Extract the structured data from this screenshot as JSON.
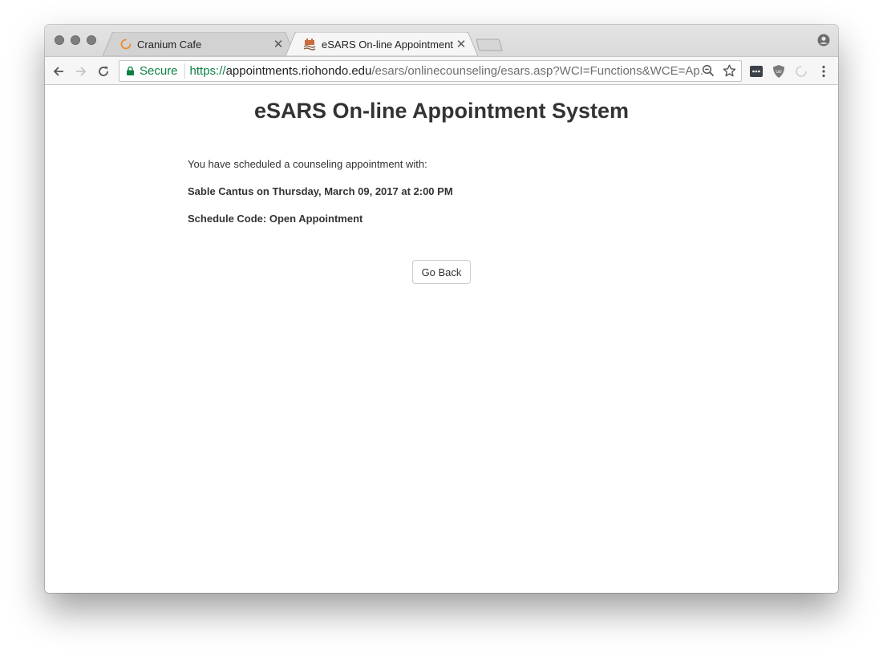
{
  "browser": {
    "tabs": [
      {
        "title": "Cranium Cafe",
        "icon": "loading-spinner-icon",
        "active": false
      },
      {
        "title": "eSARS On-line Appointment S",
        "icon": "college-logo-icon",
        "active": true
      }
    ],
    "toolbar": {
      "secure_label": "Secure",
      "url_scheme": "https://",
      "url_host": "appointments.riohondo.edu",
      "url_path": "/esars/onlinecounseling/esars.asp?WCI=Functions&WCE=Ap..."
    },
    "colors": {
      "secure_green": "#0b8043",
      "spinner_orange": "#f28c28"
    }
  },
  "page": {
    "title": "eSARS On-line Appointment System",
    "intro": "You have scheduled a counseling appointment with:",
    "appointment": "Sable Cantus on Thursday, March 09, 2017 at 2:00 PM",
    "schedule_code": "Schedule Code: Open Appointment",
    "go_back_label": "Go Back"
  }
}
